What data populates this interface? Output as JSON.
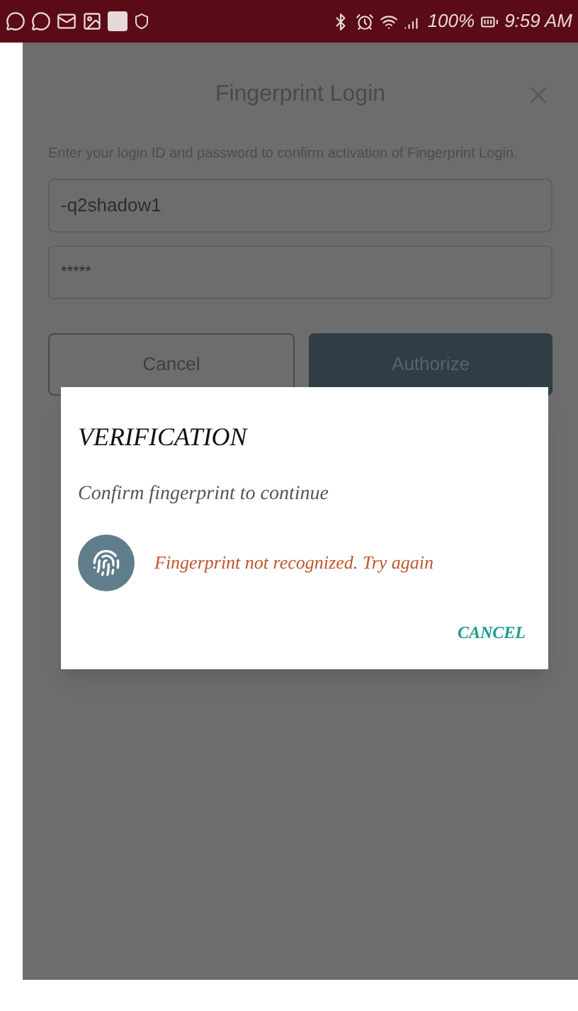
{
  "status_bar": {
    "battery": "100%",
    "time": "9:59 AM"
  },
  "login_sheet": {
    "title": "Fingerprint Login",
    "description": "Enter your login ID and password to confirm activation of Fingerprint Login.",
    "login_id": {
      "value": "-q2shadow1"
    },
    "password": {
      "value": "*****"
    },
    "buttons": [
      {
        "label": "Cancel",
        "kind": "outline"
      },
      {
        "label": "Authorize",
        "kind": "primary"
      }
    ]
  },
  "verification_dialog": {
    "title": "VERIFICATION",
    "prompt": "Confirm fingerprint to continue",
    "error": "Fingerprint not recognized. Try again",
    "action": "CANCEL"
  }
}
